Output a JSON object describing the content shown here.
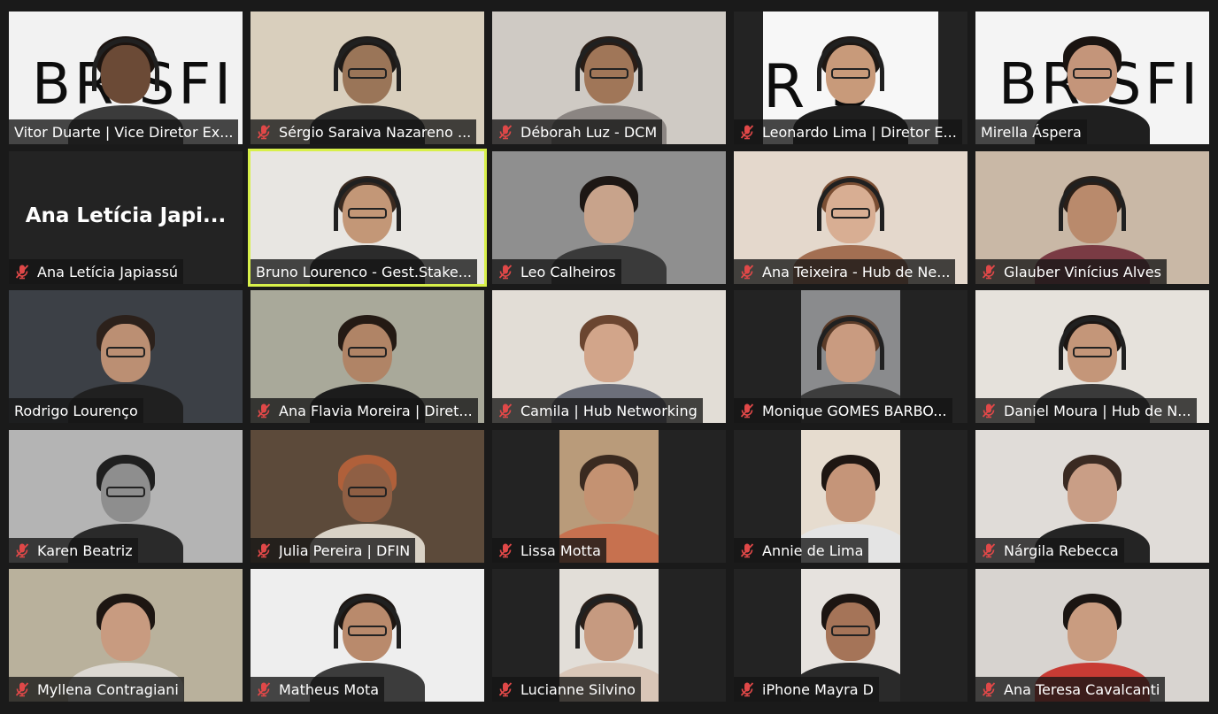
{
  "meeting": {
    "participants": [
      {
        "name": "Vitor Duarte | Vice Diretor Ex...",
        "muted": false,
        "bg": "#f2f2f2",
        "bg_text": "BR SFI",
        "skin": "#6b4a36",
        "hair": "#1c1410",
        "shirt": "#3b3b3b",
        "glasses": false,
        "headset": true,
        "video": "full"
      },
      {
        "name": "Sérgio Saraiva Nazareno ...",
        "muted": true,
        "bg": "#d9cfbd",
        "skin": "#9a7558",
        "hair": "#1e1a17",
        "shirt": "#2c2c2c",
        "glasses": true,
        "headset": true,
        "video": "full"
      },
      {
        "name": "Déborah Luz - DCM",
        "muted": true,
        "bg": "#cfcac4",
        "skin": "#a07658",
        "hair": "#2a1d16",
        "shirt": "#8b8582",
        "glasses": true,
        "headset": true,
        "video": "full"
      },
      {
        "name": "Leonardo Lima | Diretor E...",
        "muted": true,
        "bg": "#f7f7f7",
        "bg_text": "R S",
        "skin": "#c89a7a",
        "hair": "#1e1814",
        "shirt": "#1e1e1e",
        "glasses": true,
        "headset": true,
        "video": "pillar"
      },
      {
        "name": "Mirella Áspera",
        "muted": false,
        "bg": "#f4f4f4",
        "bg_text": "BR SFI",
        "skin": "#c4957a",
        "hair": "#1a1411",
        "shirt": "#1f1f1f",
        "glasses": true,
        "headset": false,
        "video": "full"
      },
      {
        "name": "Ana Letícia Japiassú",
        "muted": true,
        "bg": "#232323",
        "big_name": "Ana Letícia Japi...",
        "video": "none"
      },
      {
        "name": "Bruno Lourenco - Gest.Stake...",
        "muted": false,
        "bg": "#e8e6e2",
        "skin": "#c39777",
        "hair": "#3a2a20",
        "shirt": "#2b2b2b",
        "glasses": true,
        "headset": true,
        "video": "full",
        "active": true
      },
      {
        "name": "Leo Calheiros",
        "muted": true,
        "bg": "#8f8f8f",
        "skin": "#c8a38b",
        "hair": "#1d1714",
        "shirt": "#3a3a3a",
        "glasses": false,
        "headset": false,
        "video": "full"
      },
      {
        "name": "Ana Teixeira - Hub de Ne...",
        "muted": true,
        "bg": "#e4d8cc",
        "skin": "#d8ae93",
        "hair": "#7a4e33",
        "shirt": "#a36f52",
        "glasses": true,
        "headset": true,
        "video": "full"
      },
      {
        "name": "Glauber Vinícius Alves",
        "muted": true,
        "bg": "#c9b8a6",
        "skin": "#b98a6c",
        "hair": "#2a1f18",
        "shirt": "#7a3b44",
        "glasses": false,
        "headset": true,
        "video": "full"
      },
      {
        "name": "Rodrigo Lourenço",
        "muted": false,
        "bg": "#3c4046",
        "skin": "#bb8f73",
        "hair": "#2c211b",
        "shirt": "#202020",
        "glasses": true,
        "headset": false,
        "video": "full"
      },
      {
        "name": "Ana Flavia Moreira | Diret...",
        "muted": true,
        "bg": "#a9a99a",
        "skin": "#b08466",
        "hair": "#241a14",
        "shirt": "#1c1c1c",
        "glasses": true,
        "headset": false,
        "video": "full"
      },
      {
        "name": "Camila | Hub Networking",
        "muted": true,
        "bg": "#e2ddd6",
        "skin": "#d2a58a",
        "hair": "#6b4530",
        "shirt": "#6c6f7a",
        "glasses": false,
        "headset": false,
        "video": "full"
      },
      {
        "name": "Monique GOMES BARBO...",
        "muted": true,
        "bg": "#8a8b8d",
        "skin": "#c99b80",
        "hair": "#5a3b28",
        "shirt": "#3d3d3d",
        "glasses": false,
        "headset": true,
        "video": "pillar"
      },
      {
        "name": "Daniel Moura | Hub de N...",
        "muted": true,
        "bg": "#e6e2dc",
        "skin": "#c49679",
        "hair": "#1c1613",
        "shirt": "#3a3a3a",
        "glasses": true,
        "headset": true,
        "video": "full"
      },
      {
        "name": "Karen Beatriz",
        "muted": true,
        "bg": "#b4b4b4",
        "skin": "#8e8e8e",
        "hair": "#1f1f1f",
        "shirt": "#2a2a2a",
        "glasses": true,
        "headset": false,
        "video": "full"
      },
      {
        "name": "Julia Pereira | DFIN",
        "muted": true,
        "bg": "#5c4a3a",
        "skin": "#8f5f44",
        "hair": "#b0603a",
        "shirt": "#d9d2c6",
        "glasses": true,
        "headset": false,
        "video": "full"
      },
      {
        "name": "Lissa Motta",
        "muted": true,
        "bg": "#b99b7a",
        "skin": "#c49272",
        "hair": "#3a2a20",
        "shirt": "#c7714f",
        "glasses": false,
        "headset": false,
        "video": "pillar"
      },
      {
        "name": "Annie de Lima",
        "muted": true,
        "bg": "#e6dccf",
        "skin": "#c59579",
        "hair": "#1e1612",
        "shirt": "#e4e4e4",
        "glasses": false,
        "headset": false,
        "video": "pillar"
      },
      {
        "name": "Nárgila Rebecca",
        "muted": true,
        "bg": "#e0dcd8",
        "skin": "#c99e86",
        "hair": "#3a2a22",
        "shirt": "#242424",
        "glasses": false,
        "headset": false,
        "video": "full"
      },
      {
        "name": "Myllena Contragiani",
        "muted": true,
        "bg": "#b9b19c",
        "skin": "#c89b80",
        "hair": "#1d1612",
        "shirt": "#dcd8d2",
        "glasses": false,
        "headset": false,
        "video": "full"
      },
      {
        "name": "Matheus Mota",
        "muted": true,
        "bg": "#eeeeee",
        "skin": "#b98a6c",
        "hair": "#1d1612",
        "shirt": "#3c3c3c",
        "glasses": true,
        "headset": true,
        "video": "full"
      },
      {
        "name": "Lucianne Silvino",
        "muted": true,
        "bg": "#e2ded8",
        "skin": "#c69a80",
        "hair": "#2a1f19",
        "shirt": "#d9c6b7",
        "glasses": false,
        "headset": true,
        "video": "pillar"
      },
      {
        "name": "iPhone Mayra D",
        "muted": true,
        "bg": "#e6e2de",
        "skin": "#a57458",
        "hair": "#1c1512",
        "shirt": "#2a2a2a",
        "glasses": true,
        "headset": false,
        "video": "pillar"
      },
      {
        "name": "Ana Teresa Cavalcanti",
        "muted": true,
        "bg": "#d8d4d0",
        "skin": "#c99c80",
        "hair": "#1b1512",
        "shirt": "#c83b34",
        "glasses": false,
        "headset": false,
        "video": "full"
      }
    ]
  }
}
